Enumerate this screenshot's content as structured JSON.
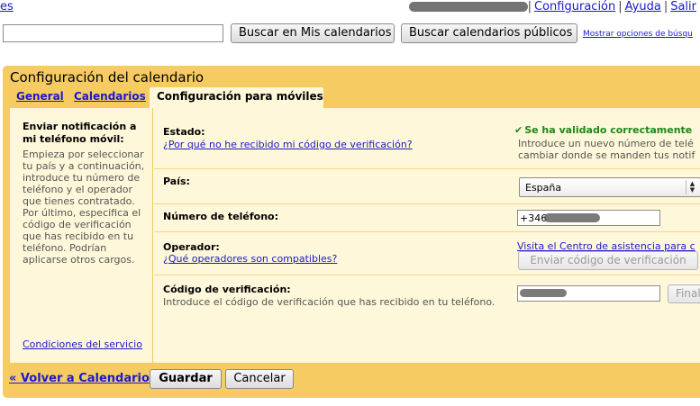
{
  "topbar": {
    "left_link": "es",
    "links": [
      "Configuración",
      "Ayuda",
      "Salir"
    ],
    "separator": "|"
  },
  "search": {
    "value": "",
    "btn_mine": "Buscar en Mis calendarios",
    "btn_public": "Buscar calendarios públicos",
    "options_link": "Mostrar opciones de búsqu"
  },
  "settings": {
    "title": "Configuración del calendario",
    "tabs": [
      {
        "label": "General",
        "active": false
      },
      {
        "label": "Calendarios",
        "active": false
      },
      {
        "label": "Configuración para móviles",
        "active": true
      }
    ],
    "left": {
      "heading": "Enviar notificación a mi teléfono móvil:",
      "description": "Empieza por seleccionar tu país y a continuación, introduce tu número de teléfono y el operador que tienes contratado. Por último, especifica el código de verificación que has recibido en tu teléfono. Podrían aplicarse otros cargos.",
      "terms_link": "Condiciones del servicio"
    },
    "status": {
      "label": "Estado:",
      "link": "¿Por qué no he recibido mi código de verificación?",
      "ok_text": "Se ha validado correctamente",
      "desc_line1": "Introduce un nuevo número de telé",
      "desc_line2": "cambiar donde se manden tus notif"
    },
    "country": {
      "label": "País:",
      "selected": "España"
    },
    "phone": {
      "label": "Número de teléfono:",
      "value": "+346"
    },
    "operator": {
      "label": "Operador:",
      "link": "¿Qué operadores son compatibles?",
      "help_link": "Visita el Centro de asistencia para c",
      "send_button": "Enviar código de verificación"
    },
    "code": {
      "label": "Código de verificación:",
      "hint": "Introduce el código de verificación que has recibido en tu teléfono.",
      "finish_button": "Finalizar"
    }
  },
  "footer": {
    "back_link": "« Volver a Calendario",
    "save": "Guardar",
    "cancel": "Cancelar"
  },
  "colors": {
    "panel": "#f6cb62",
    "content": "#fff7d9",
    "link": "#1a1acc",
    "success": "#1a8a1a"
  }
}
